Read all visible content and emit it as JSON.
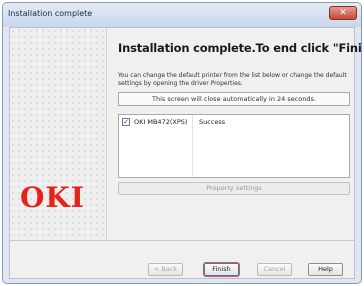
{
  "window": {
    "title": "Installation complete",
    "close_glyph": "✕"
  },
  "brand": {
    "logo": "OKI",
    "logo_color": "#e4241b"
  },
  "main": {
    "heading": "Installation complete.To end click \"Finish\".",
    "description": "You can change the default printer from the list below or change the default settings by opening the driver Properties.",
    "notice": "This screen will close automatically in 24 seconds.",
    "printers": [
      {
        "name": "OKI MB472(XPS)",
        "status": "Success",
        "checked": true
      }
    ],
    "check_glyph": "✓",
    "property_settings_label": "Property settings"
  },
  "buttons": {
    "back": "< Back",
    "finish": "Finish",
    "cancel": "Cancel",
    "help": "Help"
  }
}
